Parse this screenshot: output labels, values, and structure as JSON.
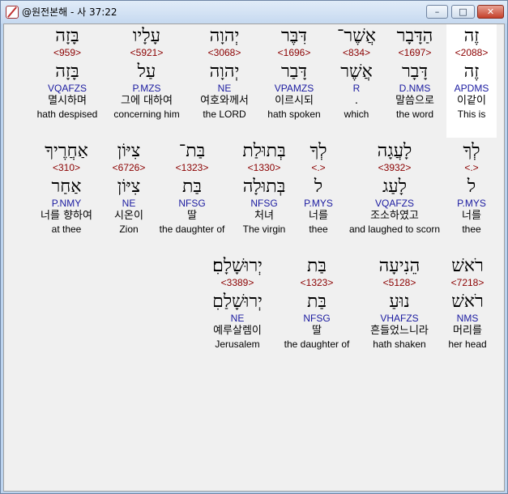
{
  "window": {
    "title": "@원전본해 - 사 37:22",
    "buttons": {
      "minimize": "–",
      "maximize": "□",
      "close": "✕"
    }
  },
  "rows": [
    [
      {
        "heb": "זֶה",
        "strong": "<2088>",
        "lemma": "זֶה",
        "morph": "APDMS",
        "kor": "이같이",
        "eng": "This is"
      },
      {
        "heb": "הַדָּבָר",
        "strong": "<1697>",
        "lemma": "דָּבָר",
        "morph": "D.NMS",
        "kor": "말씀으로",
        "eng": "the word"
      },
      {
        "heb": "אֲשֶׁר־",
        "strong": "<834>",
        "lemma": "אֲשֶׁר",
        "morph": "R",
        "kor": ".",
        "eng": "which"
      },
      {
        "heb": "דִּבֶּר",
        "strong": "<1696>",
        "lemma": "דָּבַר",
        "morph": "VPAMZS",
        "kor": "이르시되",
        "eng": "hath spoken"
      },
      {
        "heb": "יְהוָה",
        "strong": "<3068>",
        "lemma": "יְהוָה",
        "morph": "NE",
        "kor": "여호와께서",
        "eng": "the LORD"
      },
      {
        "heb": "עָלָיו",
        "strong": "<5921>",
        "lemma": "עַל",
        "morph": "P.MZS",
        "kor": "그에 대하여",
        "eng": "concerning him"
      },
      {
        "heb": "בָּזָה",
        "strong": "<959>",
        "lemma": "בָּזָה",
        "morph": "VQAFZS",
        "kor": "멸시하며",
        "eng": "hath despised"
      }
    ],
    [
      {
        "heb": "לְךָ",
        "strong": "<.>",
        "lemma": "ל",
        "morph": "P.MYS",
        "kor": "너를",
        "eng": "thee"
      },
      {
        "heb": "לָעֲגָה",
        "strong": "<3932>",
        "lemma": "לָעַג",
        "morph": "VQAFZS",
        "kor": "조소하였고",
        "eng": "and laughed to scorn"
      },
      {
        "heb": "לְךָ",
        "strong": "<.>",
        "lemma": "ל",
        "morph": "P.MYS",
        "kor": "너를",
        "eng": "thee"
      },
      {
        "heb": "בְּתוּלַת",
        "strong": "<1330>",
        "lemma": "בְּתוּלָה",
        "morph": "NFSG",
        "kor": "처녀",
        "eng": "The virgin"
      },
      {
        "heb": "בַּת־",
        "strong": "<1323>",
        "lemma": "בַּת",
        "morph": "NFSG",
        "kor": "딸",
        "eng": "the daughter of"
      },
      {
        "heb": "צִיּוֹן",
        "strong": "<6726>",
        "lemma": "צִיּוֹן",
        "morph": "NE",
        "kor": "시온이",
        "eng": "Zion"
      },
      {
        "heb": "אַחֲרֶיךָ",
        "strong": "<310>",
        "lemma": "אַחַר",
        "morph": "P.NMY",
        "kor": "너를 향하여",
        "eng": "at thee"
      }
    ],
    [
      {
        "heb": "רֹאשׁ",
        "strong": "<7218>",
        "lemma": "רֹאשׁ",
        "morph": "NMS",
        "kor": "머리를",
        "eng": "her head"
      },
      {
        "heb": "הֵנִיעָה",
        "strong": "<5128>",
        "lemma": "נוּעַ",
        "morph": "VHAFZS",
        "kor": "흔들었느니라",
        "eng": "hath shaken"
      },
      {
        "heb": "בַּת",
        "strong": "<1323>",
        "lemma": "בַּת",
        "morph": "NFSG",
        "kor": "딸",
        "eng": "the daughter of"
      },
      {
        "heb": "יְרוּשָׁלָםִ׃",
        "strong": "<3389>",
        "lemma": "יְרוּשָׁלַםִ",
        "morph": "NE",
        "kor": "예루살렘이",
        "eng": "Jerusalem"
      }
    ]
  ]
}
